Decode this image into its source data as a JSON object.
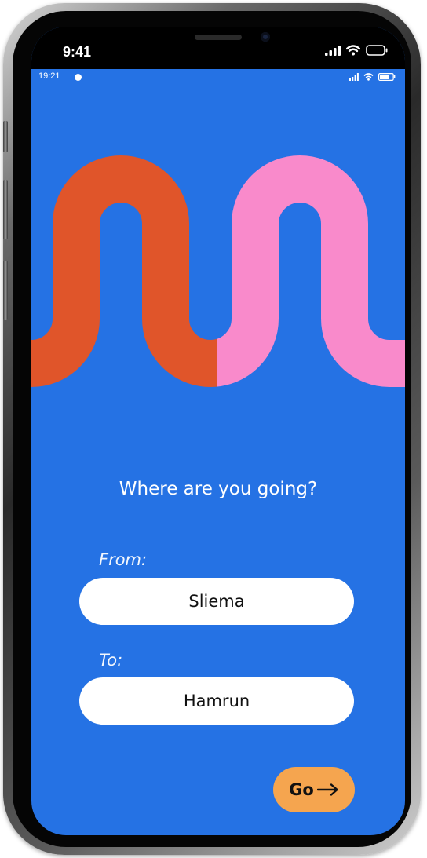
{
  "ios_status": {
    "time": "9:41",
    "signal_icon": "signal-bars-icon",
    "wifi_icon": "wifi-icon",
    "battery_icon": "battery-icon"
  },
  "app_status": {
    "time": "19:21",
    "notification_icon": "notification-dot-icon",
    "signal_icon": "signal-bars-icon",
    "wifi_icon": "wifi-icon",
    "battery_icon": "battery-icon",
    "battery_level": 0.7
  },
  "hero": {
    "shape_icon": "wave-path-icon",
    "colors": {
      "left": "#E0552A",
      "right": "#F98ACB",
      "background": "#2572E4"
    }
  },
  "main": {
    "question": "Where are you going?",
    "from": {
      "label": "From:",
      "value": "Sliema"
    },
    "to": {
      "label": "To:",
      "value": "Hamrun"
    },
    "go_button": {
      "label": "Go",
      "icon": "arrow-right-icon",
      "color": "#F5A54F"
    }
  }
}
